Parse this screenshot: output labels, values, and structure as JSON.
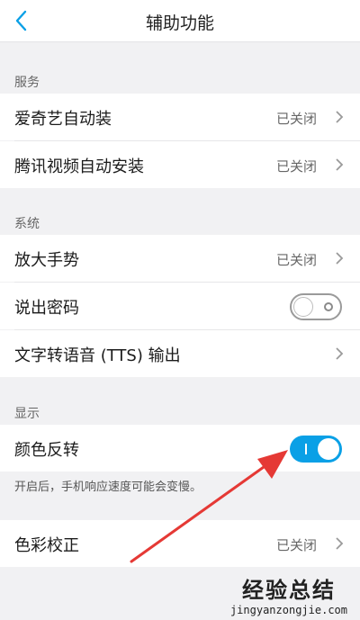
{
  "header": {
    "title": "辅助功能",
    "back_icon": "chevron-left-icon",
    "accent": "#0aa0e6"
  },
  "sections": {
    "services": {
      "label": "服务",
      "items": [
        {
          "label": "爱奇艺自动装",
          "value": "已关闭"
        },
        {
          "label": "腾讯视频自动安装",
          "value": "已关闭"
        }
      ]
    },
    "system": {
      "label": "系统",
      "items": [
        {
          "label": "放大手势",
          "value": "已关闭"
        },
        {
          "label": "说出密码",
          "toggle": "off"
        },
        {
          "label": "文字转语音 (TTS) 输出"
        }
      ]
    },
    "display": {
      "label": "显示",
      "items": [
        {
          "label": "颜色反转",
          "toggle": "on"
        }
      ],
      "hint": "开启后，手机响应速度可能会变慢。"
    },
    "color": {
      "items": [
        {
          "label": "色彩校正",
          "value": "已关闭"
        }
      ]
    }
  },
  "watermark": {
    "title": "经验总结",
    "url": "jingyanzongjie.com"
  },
  "annotation": {
    "arrow_color": "#e53935"
  }
}
